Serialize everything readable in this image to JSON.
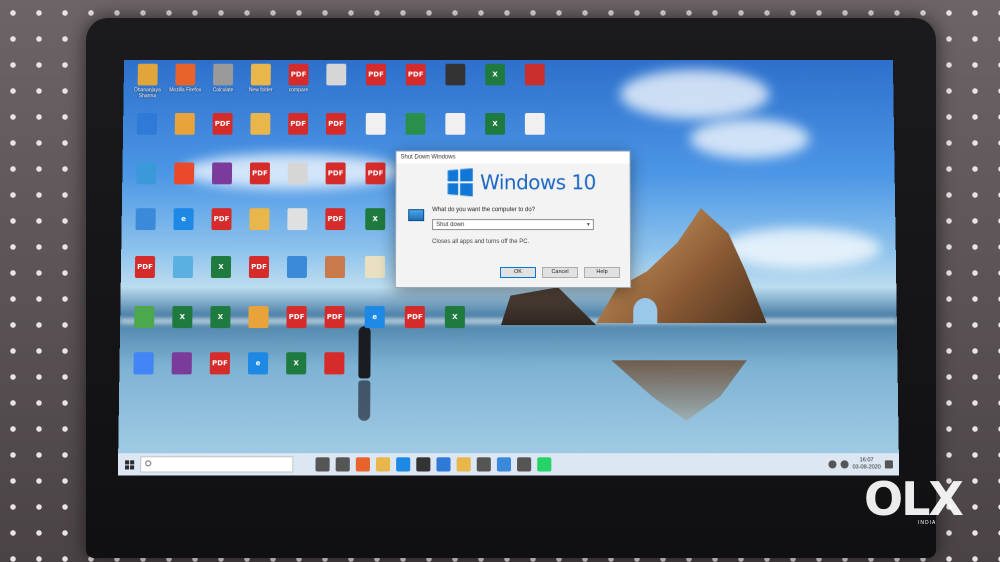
{
  "desktop_icons": [
    {
      "label": "Dhananjaya Sharma",
      "color": "#e1a53a",
      "glyph": ""
    },
    {
      "label": "Mozilla Firefox",
      "color": "#e8622b",
      "glyph": ""
    },
    {
      "label": "Calculate",
      "color": "#9a9a9a",
      "glyph": ""
    },
    {
      "label": "New folder",
      "color": "#e8b64a",
      "glyph": ""
    },
    {
      "label": "compare",
      "color": "#d52b2b",
      "glyph": "PDF"
    },
    {
      "label": "",
      "color": "#d6d6d6",
      "glyph": ""
    },
    {
      "label": "",
      "color": "#d52b2b",
      "glyph": "PDF"
    },
    {
      "label": "",
      "color": "#d52b2b",
      "glyph": "PDF"
    },
    {
      "label": "",
      "color": "#333333",
      "glyph": ""
    },
    {
      "label": "",
      "color": "#1f7a3f",
      "glyph": "X"
    },
    {
      "label": "",
      "color": "#c9302c",
      "glyph": ""
    },
    {
      "label": "",
      "color": "#2f7ad6",
      "glyph": ""
    },
    {
      "label": "",
      "color": "#e8a33a",
      "glyph": ""
    },
    {
      "label": "",
      "color": "#d52b2b",
      "glyph": "PDF"
    },
    {
      "label": "",
      "color": "#e8b64a",
      "glyph": ""
    },
    {
      "label": "",
      "color": "#d52b2b",
      "glyph": "PDF"
    },
    {
      "label": "",
      "color": "#d52b2b",
      "glyph": "PDF"
    },
    {
      "label": "",
      "color": "#f0f0f0",
      "glyph": ""
    },
    {
      "label": "",
      "color": "#2a8f4a",
      "glyph": ""
    },
    {
      "label": "",
      "color": "#f0f0f0",
      "glyph": ""
    },
    {
      "label": "",
      "color": "#1f7a3f",
      "glyph": "X"
    },
    {
      "label": "",
      "color": "#f0f0f0",
      "glyph": ""
    },
    {
      "label": "",
      "color": "#3a9ad9",
      "glyph": ""
    },
    {
      "label": "",
      "color": "#e84a2b",
      "glyph": ""
    },
    {
      "label": "",
      "color": "#7a3b9a",
      "glyph": ""
    },
    {
      "label": "",
      "color": "#d52b2b",
      "glyph": "PDF"
    },
    {
      "label": "",
      "color": "#d6d6d6",
      "glyph": ""
    },
    {
      "label": "",
      "color": "#d52b2b",
      "glyph": "PDF"
    },
    {
      "label": "",
      "color": "#d52b2b",
      "glyph": "PDF"
    },
    {
      "label": "",
      "color": "#3a8ad9",
      "glyph": ""
    },
    {
      "label": "",
      "color": "#1e88e5",
      "glyph": "e"
    },
    {
      "label": "",
      "color": "#d52b2b",
      "glyph": "PDF"
    },
    {
      "label": "",
      "color": "#e8b64a",
      "glyph": ""
    },
    {
      "label": "",
      "color": "#e0e0e0",
      "glyph": ""
    },
    {
      "label": "",
      "color": "#d52b2b",
      "glyph": "PDF"
    },
    {
      "label": "",
      "color": "#1f7a3f",
      "glyph": "X"
    },
    {
      "label": "",
      "color": "#d52b2b",
      "glyph": "PDF"
    },
    {
      "label": "",
      "color": "#5ab0e0",
      "glyph": ""
    },
    {
      "label": "",
      "color": "#1f7a3f",
      "glyph": "X"
    },
    {
      "label": "",
      "color": "#d52b2b",
      "glyph": "PDF"
    },
    {
      "label": "",
      "color": "#3a8ad9",
      "glyph": ""
    },
    {
      "label": "",
      "color": "#c97a4a",
      "glyph": ""
    },
    {
      "label": "",
      "color": "#e8e0c0",
      "glyph": ""
    },
    {
      "label": "",
      "color": "#d52b2b",
      "glyph": "PDF"
    },
    {
      "label": "",
      "color": "#d52b2b",
      "glyph": "PDF"
    },
    {
      "label": "",
      "color": "#d52b2b",
      "glyph": "A"
    },
    {
      "label": "",
      "color": "#4ca84c",
      "glyph": ""
    },
    {
      "label": "",
      "color": "#1f7a3f",
      "glyph": "X"
    },
    {
      "label": "",
      "color": "#1f7a3f",
      "glyph": "X"
    },
    {
      "label": "",
      "color": "#e8a33a",
      "glyph": ""
    },
    {
      "label": "",
      "color": "#d52b2b",
      "glyph": "PDF"
    },
    {
      "label": "",
      "color": "#d52b2b",
      "glyph": "PDF"
    },
    {
      "label": "",
      "color": "#1e88e5",
      "glyph": "e"
    },
    {
      "label": "",
      "color": "#d52b2b",
      "glyph": "PDF"
    },
    {
      "label": "",
      "color": "#1f7a3f",
      "glyph": "X"
    },
    {
      "label": "",
      "color": "#4285f4",
      "glyph": ""
    },
    {
      "label": "",
      "color": "#7a3b9a",
      "glyph": ""
    },
    {
      "label": "",
      "color": "#d52b2b",
      "glyph": "PDF"
    },
    {
      "label": "",
      "color": "#1e88e5",
      "glyph": "e"
    },
    {
      "label": "",
      "color": "#1f7a3f",
      "glyph": "X"
    },
    {
      "label": "",
      "color": "#d52b2b",
      "glyph": ""
    }
  ],
  "dialog": {
    "title": "Shut Down Windows",
    "brand": "Windows 10",
    "question": "What do you want the computer to do?",
    "selected_option": "Shut down",
    "description": "Closes all apps and turns off the PC.",
    "ok_label": "OK",
    "cancel_label": "Cancel",
    "help_label": "Help"
  },
  "taskbar": {
    "search_placeholder": "",
    "time": "16:07",
    "date": "03-08-2020",
    "pinned_icon_colors": [
      "#555555",
      "#555555",
      "#e8622b",
      "#e8b64a",
      "#1e88e5",
      "#333333",
      "#2f7ad6",
      "#e8b64a",
      "#555555",
      "#3a8ad9",
      "#555555",
      "#25d366"
    ]
  },
  "watermark": {
    "brand": "OLX",
    "region": "INDIA"
  }
}
